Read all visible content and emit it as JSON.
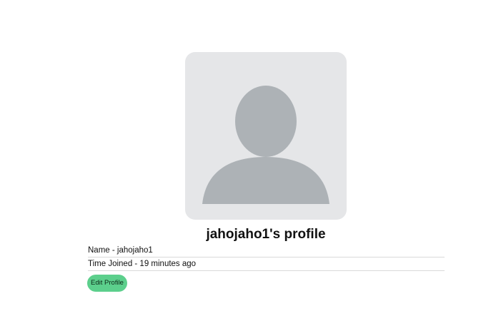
{
  "profile": {
    "title": "jahojaho1's profile",
    "avatar_icon": "default-user-avatar-icon",
    "fields": [
      {
        "text": "Name - jahojaho1"
      },
      {
        "text": "Time Joined - 19 minutes ago"
      }
    ],
    "edit_button_label": "Edit Profile"
  },
  "colors": {
    "avatar_background": "#e5e6e8",
    "avatar_silhouette": "#adb2b6",
    "button_background": "#5ccf8c",
    "divider": "#d9d9d9"
  }
}
